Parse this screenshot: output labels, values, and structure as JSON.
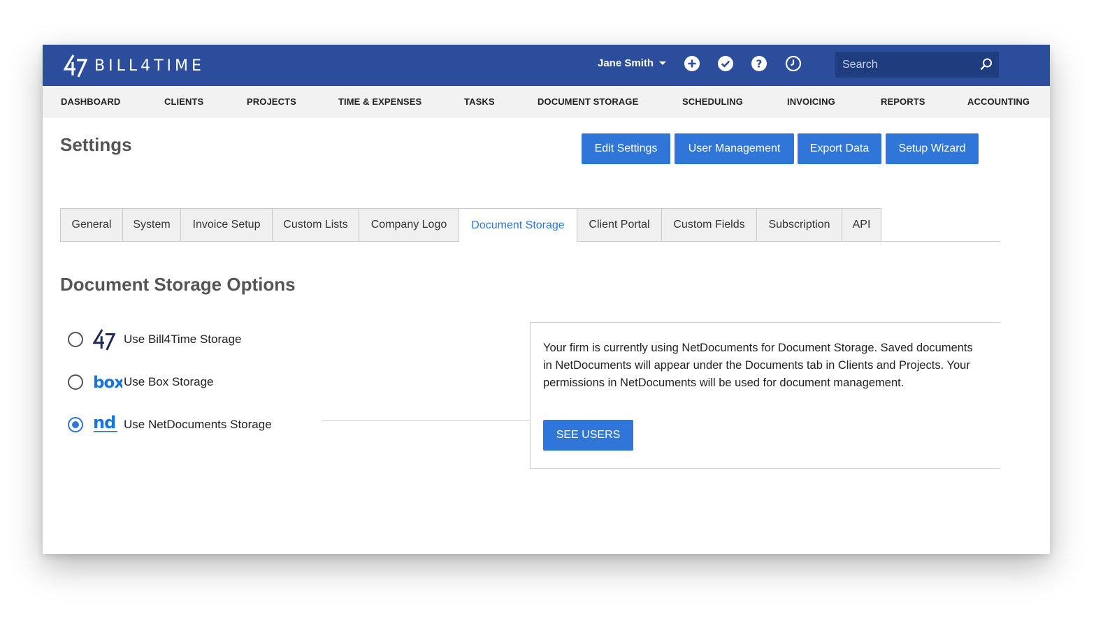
{
  "app": {
    "brand": "BILL4TIME",
    "accent": "#2f76d8",
    "header_bg": "#2b4d9b"
  },
  "header": {
    "user_name": "Jane Smith",
    "icons": [
      "plus-circle-icon",
      "check-circle-icon",
      "help-circle-icon",
      "clock-icon"
    ],
    "search_placeholder": "Search"
  },
  "nav": {
    "items": [
      "DASHBOARD",
      "CLIENTS",
      "PROJECTS",
      "TIME & EXPENSES",
      "TASKS",
      "DOCUMENT STORAGE",
      "SCHEDULING",
      "INVOICING",
      "REPORTS",
      "ACCOUNTING"
    ]
  },
  "page": {
    "title": "Settings",
    "actions": [
      "Edit Settings",
      "User Management",
      "Export Data",
      "Setup Wizard"
    ]
  },
  "tabs": {
    "items": [
      "General",
      "System",
      "Invoice Setup",
      "Custom Lists",
      "Company Logo",
      "Document Storage",
      "Client Portal",
      "Custom Fields",
      "Subscription",
      "API"
    ],
    "active": "Document Storage"
  },
  "storage": {
    "title": "Document Storage Options",
    "options": [
      {
        "label": "Use Bill4Time Storage",
        "logo": "bill4time-logo",
        "checked": false
      },
      {
        "label": "Use Box Storage",
        "logo": "box-logo",
        "checked": false
      },
      {
        "label": "Use NetDocuments Storage",
        "logo": "netdocuments-logo",
        "checked": true
      }
    ],
    "info_text": "Your firm is currently using NetDocuments for Document Storage. Saved documents in NetDocuments will appear under the Documents tab in Clients and Projects. Your permissions in NetDocuments will be used for document management.",
    "see_users_label": "SEE USERS"
  }
}
